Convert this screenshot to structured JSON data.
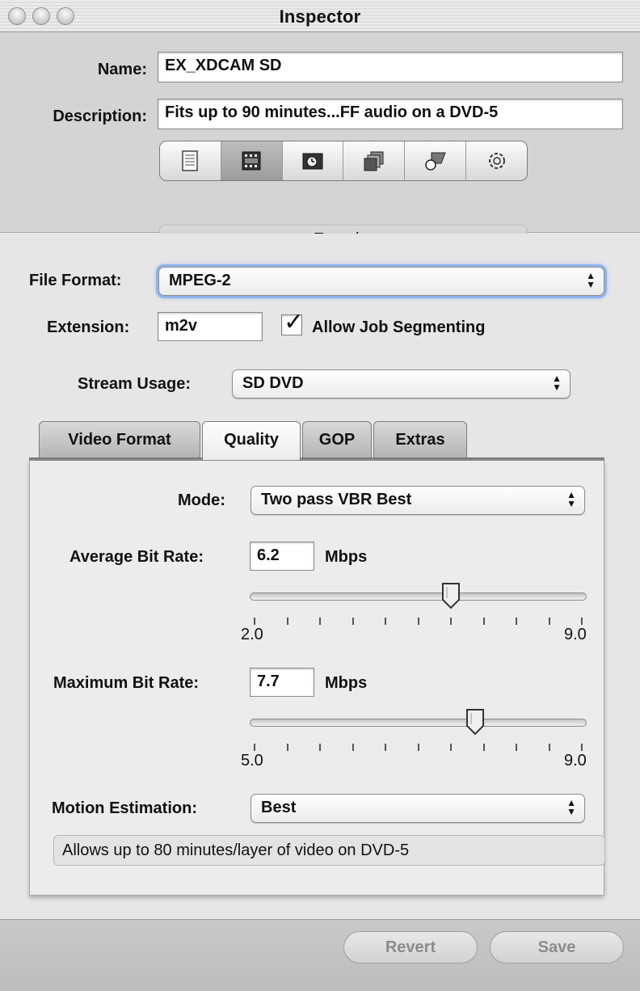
{
  "window": {
    "title": "Inspector"
  },
  "header": {
    "name_label": "Name:",
    "name_value": "EX_XDCAM SD",
    "description_label": "Description:",
    "description_value": "Fits up to 90 minutes...FF audio on a DVD-5",
    "panel_icons": [
      "summary-icon",
      "encoder-icon",
      "frame-controls-icon",
      "filters-icon",
      "geometry-icon",
      "actions-icon"
    ],
    "selected_panel": "Encoder"
  },
  "encoder": {
    "file_format_label": "File Format:",
    "file_format_value": "MPEG-2",
    "extension_label": "Extension:",
    "extension_value": "m2v",
    "allow_segmenting_label": "Allow Job Segmenting",
    "allow_segmenting_checked": true,
    "stream_usage_label": "Stream Usage:",
    "stream_usage_value": "SD DVD",
    "tabs": [
      "Video Format",
      "Quality",
      "GOP",
      "Extras"
    ],
    "active_tab": "Quality"
  },
  "quality": {
    "mode_label": "Mode:",
    "mode_value": "Two pass VBR Best",
    "avg_label": "Average Bit Rate:",
    "avg_value": "6.2",
    "avg_unit": "Mbps",
    "avg_min": "2.0",
    "avg_max": "9.0",
    "avg_slider": {
      "min": 2.0,
      "max": 9.0,
      "value": 6.2
    },
    "max_label": "Maximum Bit Rate:",
    "max_value": "7.7",
    "max_unit": "Mbps",
    "max_min": "5.0",
    "max_max": "9.0",
    "max_slider": {
      "min": 5.0,
      "max": 9.0,
      "value": 7.7
    },
    "motion_label": "Motion Estimation:",
    "motion_value": "Best",
    "info_text": "Allows up to 80 minutes/layer of video on DVD-5"
  },
  "footer": {
    "revert_label": "Revert",
    "save_label": "Save"
  }
}
